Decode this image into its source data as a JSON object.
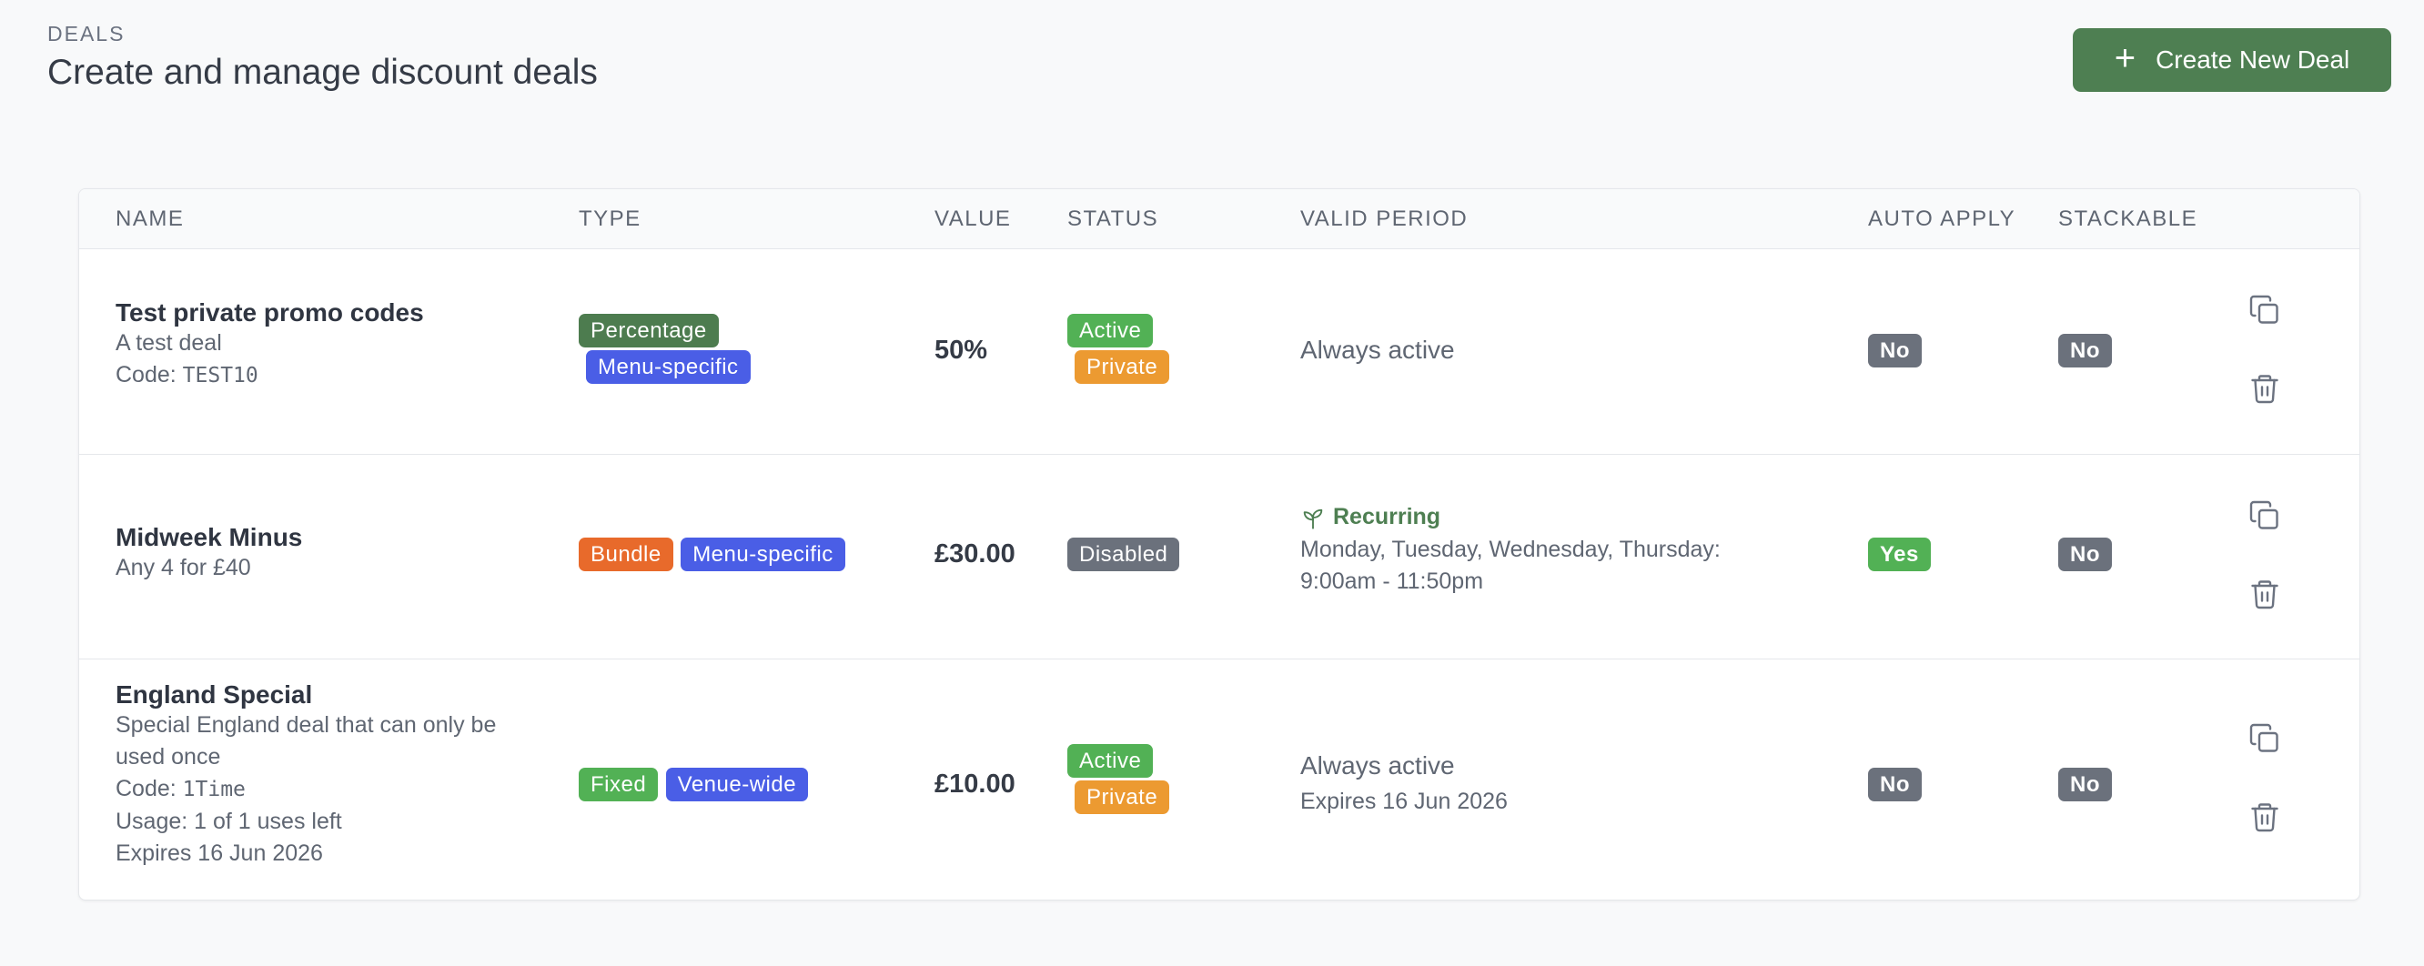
{
  "header": {
    "eyebrow": "DEALS",
    "title": "Create and manage discount deals",
    "create_button": "Create New Deal"
  },
  "table": {
    "columns": [
      "NAME",
      "TYPE",
      "VALUE",
      "STATUS",
      "VALID PERIOD",
      "AUTO APPLY",
      "STACKABLE"
    ],
    "rows": [
      {
        "name": "Test private promo codes",
        "description": "A test deal",
        "code_label": "Code: ",
        "code": "TEST10",
        "types": [
          "Percentage",
          "Menu-specific"
        ],
        "value": "50%",
        "status": [
          "Active",
          "Private"
        ],
        "period": "Always active",
        "auto_apply": "No",
        "stackable": "No"
      },
      {
        "name": "Midweek Minus",
        "description": "Any 4 for £40",
        "types": [
          "Bundle",
          "Menu-specific"
        ],
        "value": "£30.00",
        "status": [
          "Disabled"
        ],
        "recurring_label": "Recurring",
        "period_line1": "Monday, Tuesday, Wednesday, Thursday:",
        "period_line2": "9:00am - 11:50pm",
        "auto_apply": "Yes",
        "stackable": "No"
      },
      {
        "name": "England Special",
        "description_line1": "Special England deal that can only be",
        "description_line2": "used once",
        "code_label": "Code: ",
        "code": "1Time",
        "usage": "Usage: 1 of 1 uses left",
        "expires": "Expires 16 Jun 2026",
        "types": [
          "Fixed",
          "Venue-wide"
        ],
        "value": "£10.00",
        "status": [
          "Active",
          "Private"
        ],
        "period": "Always active",
        "period_sub": "Expires 16 Jun 2026",
        "auto_apply": "No",
        "stackable": "No"
      }
    ]
  },
  "icons": {
    "duplicate": "copy-icon",
    "delete": "trash-icon",
    "recurring": "sprout-icon",
    "create": "plus-icon"
  },
  "colors": {
    "primary_green": "#4e7f52",
    "type_percentage": "#4d7c4f",
    "type_menu": "#4a5ee6",
    "type_bundle": "#e86a2b",
    "type_fixed": "#52b155",
    "status_active": "#52b155",
    "status_private": "#ec9a31",
    "status_disabled": "#6b717c",
    "flag_no": "#6b717c",
    "flag_yes": "#52b155"
  }
}
